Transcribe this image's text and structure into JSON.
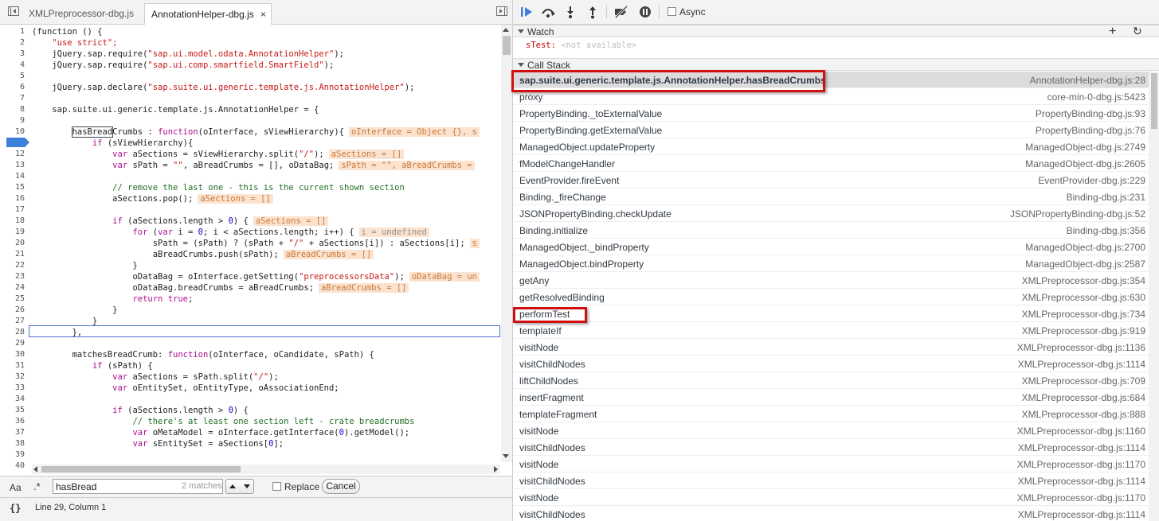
{
  "editor": {
    "tabs": [
      {
        "label": "XMLPreprocessor-dbg.js"
      },
      {
        "label": "AnnotationHelper-dbg.js",
        "close": "×"
      }
    ],
    "current_line": 11,
    "lines": [
      {
        "n": "1"
      },
      {
        "n": "2"
      },
      {
        "n": "3"
      },
      {
        "n": "4"
      },
      {
        "n": "5"
      },
      {
        "n": "6"
      },
      {
        "n": "7"
      },
      {
        "n": "8"
      },
      {
        "n": "9"
      },
      {
        "n": "10"
      },
      {
        "n": "11"
      },
      {
        "n": "12"
      },
      {
        "n": "13"
      },
      {
        "n": "14"
      },
      {
        "n": "15"
      },
      {
        "n": "16"
      },
      {
        "n": "17"
      },
      {
        "n": "18"
      },
      {
        "n": "19"
      },
      {
        "n": "20"
      },
      {
        "n": "21"
      },
      {
        "n": "22"
      },
      {
        "n": "23"
      },
      {
        "n": "24"
      },
      {
        "n": "25"
      },
      {
        "n": "26"
      },
      {
        "n": "27"
      },
      {
        "n": "28"
      },
      {
        "n": "29"
      },
      {
        "n": "30"
      },
      {
        "n": "31"
      },
      {
        "n": "32"
      },
      {
        "n": "33"
      },
      {
        "n": "34"
      },
      {
        "n": "35"
      },
      {
        "n": "36"
      },
      {
        "n": "37"
      },
      {
        "n": "38"
      },
      {
        "n": "39"
      },
      {
        "n": "40"
      }
    ],
    "code": {
      "l1": "(function () {",
      "l2": "\"use strict\";",
      "l3a": "jQuery.sap.require(",
      "l3b": "\"sap.ui.model.odata.AnnotationHelper\"",
      "l3c": ");",
      "l4a": "jQuery.sap.require(",
      "l4b": "\"sap.ui.comp.smartfield.SmartField\"",
      "l4c": ");",
      "l6a": "jQuery.sap.declare(",
      "l6b": "\"sap.suite.ui.generic.template.js.AnnotationHelper\"",
      "l6c": ");",
      "l8": "sap.suite.ui.generic.template.js.AnnotationHelper = {",
      "l10a": "hasBread",
      "l10b": "Crumbs : ",
      "l10c": "function",
      "l10d": "(oInterface, sViewHierarchy){",
      "l10e": "oInterface = Object {}, s",
      "l11a": "if",
      "l11b": " (sViewHierarchy){",
      "l12a": "var",
      "l12b": " aSections = sViewHierarchy.split(",
      "l12c": "\"/\"",
      "l12d": ");",
      "l12e": "aSections = []",
      "l13a": "var",
      "l13b": " sPath = ",
      "l13c": "\"\"",
      "l13d": ", aBreadCrumbs = [], oDataBag;",
      "l13e": "sPath = \"\", aBreadCrumbs =",
      "l15": "// remove the last one - this is the current shown section",
      "l16a": "aSections.pop();",
      "l16b": "aSections = []",
      "l18a": "if",
      "l18b": " (aSections.length > ",
      "l18c": "0",
      "l18d": ") {",
      "l18e": "aSections = []",
      "l19a": "for",
      "l19b": " (",
      "l19c": "var",
      "l19d": " i = ",
      "l19e": "0",
      "l19f": "; i < aSections.length; i++) {",
      "l19g": "i = undefined",
      "l20a": "sPath = (sPath) ? (sPath + ",
      "l20b": "\"/\"",
      "l20c": " + aSections[i]) : aSections[i];",
      "l20d": "s",
      "l21a": "aBreadCrumbs.push(sPath);",
      "l21b": "aBreadCrumbs = []",
      "l22": "}",
      "l23a": "oDataBag = oInterface.getSetting(",
      "l23b": "\"preprocessorsData\"",
      "l23c": ");",
      "l23d": "oDataBag = un",
      "l24a": "oDataBag.breadCrumbs = aBreadCrumbs;",
      "l24b": "aBreadCrumbs = []",
      "l25a": "return",
      "l25b": " ",
      "l25c": "true",
      "l25d": ";",
      "l26": "}",
      "l27": "}",
      "l28": "},",
      "l30a": "matchesBreadCrumb: ",
      "l30b": "function",
      "l30c": "(oInterface, oCandidate, sPath) {",
      "l31a": "if",
      "l31b": " (sPath) {",
      "l32a": "var",
      "l32b": " aSections = sPath.split(",
      "l32c": "\"/\"",
      "l32d": ");",
      "l33a": "var",
      "l33b": " oEntitySet, oEntityType, oAssociationEnd;",
      "l35a": "if",
      "l35b": " (aSections.length > ",
      "l35c": "0",
      "l35d": ") {",
      "l36": "// there's at least one section left - crate breadcrumbs",
      "l37a": "var",
      "l37b": " oMetaModel = oInterface.getInterface(",
      "l37c": "0",
      "l37d": ").getModel();",
      "l38a": "var",
      "l38b": " sEntitySet = aSections[",
      "l38c": "0",
      "l38d": "];"
    }
  },
  "search": {
    "case_label": "Aa",
    "regex_label": ".*",
    "query": "hasBread",
    "match_count": "2 matches",
    "replace_label": "Replace",
    "cancel_label": "Cancel"
  },
  "status": {
    "braces": "{}",
    "position": "Line 29, Column 1"
  },
  "debugger": {
    "async_label": "Async",
    "watch": {
      "title": "Watch",
      "add": "+",
      "refresh": "↻",
      "expr_name": "sTest:",
      "expr_value": "<not available>"
    },
    "call_stack": {
      "title": "Call Stack",
      "frames": [
        {
          "fn": "sap.suite.ui.generic.template.js.AnnotationHelper.hasBreadCrumbs",
          "loc": "AnnotationHelper-dbg.js:28"
        },
        {
          "fn": "proxy",
          "loc": "core-min-0-dbg.js:5423"
        },
        {
          "fn": "PropertyBinding._toExternalValue",
          "loc": "PropertyBinding-dbg.js:93"
        },
        {
          "fn": "PropertyBinding.getExternalValue",
          "loc": "PropertyBinding-dbg.js:76"
        },
        {
          "fn": "ManagedObject.updateProperty",
          "loc": "ManagedObject-dbg.js:2749"
        },
        {
          "fn": "fModelChangeHandler",
          "loc": "ManagedObject-dbg.js:2605"
        },
        {
          "fn": "EventProvider.fireEvent",
          "loc": "EventProvider-dbg.js:229"
        },
        {
          "fn": "Binding._fireChange",
          "loc": "Binding-dbg.js:231"
        },
        {
          "fn": "JSONPropertyBinding.checkUpdate",
          "loc": "JSONPropertyBinding-dbg.js:52"
        },
        {
          "fn": "Binding.initialize",
          "loc": "Binding-dbg.js:356"
        },
        {
          "fn": "ManagedObject._bindProperty",
          "loc": "ManagedObject-dbg.js:2700"
        },
        {
          "fn": "ManagedObject.bindProperty",
          "loc": "ManagedObject-dbg.js:2587"
        },
        {
          "fn": "getAny",
          "loc": "XMLPreprocessor-dbg.js:354"
        },
        {
          "fn": "getResolvedBinding",
          "loc": "XMLPreprocessor-dbg.js:630"
        },
        {
          "fn": "performTest",
          "loc": "XMLPreprocessor-dbg.js:734"
        },
        {
          "fn": "templateIf",
          "loc": "XMLPreprocessor-dbg.js:919"
        },
        {
          "fn": "visitNode",
          "loc": "XMLPreprocessor-dbg.js:1136"
        },
        {
          "fn": "visitChildNodes",
          "loc": "XMLPreprocessor-dbg.js:1114"
        },
        {
          "fn": "liftChildNodes",
          "loc": "XMLPreprocessor-dbg.js:709"
        },
        {
          "fn": "insertFragment",
          "loc": "XMLPreprocessor-dbg.js:684"
        },
        {
          "fn": "templateFragment",
          "loc": "XMLPreprocessor-dbg.js:888"
        },
        {
          "fn": "visitNode",
          "loc": "XMLPreprocessor-dbg.js:1160"
        },
        {
          "fn": "visitChildNodes",
          "loc": "XMLPreprocessor-dbg.js:1114"
        },
        {
          "fn": "visitNode",
          "loc": "XMLPreprocessor-dbg.js:1170"
        },
        {
          "fn": "visitChildNodes",
          "loc": "XMLPreprocessor-dbg.js:1114"
        },
        {
          "fn": "visitNode",
          "loc": "XMLPreprocessor-dbg.js:1170"
        },
        {
          "fn": "visitChildNodes",
          "loc": "XMLPreprocessor-dbg.js:1114"
        }
      ]
    }
  },
  "colors": {
    "highlight_border": "#d01010",
    "breakpoint": "#3e7fd9",
    "inline_value_bg": "#fbe3d0"
  }
}
